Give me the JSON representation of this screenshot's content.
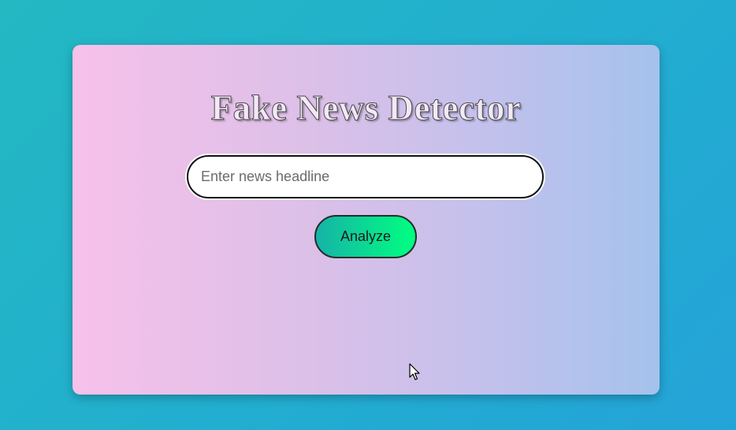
{
  "page": {
    "title": "Fake News Detector"
  },
  "search": {
    "placeholder": "Enter news headline",
    "value": ""
  },
  "actions": {
    "analyze_label": "Analyze"
  },
  "icons": {
    "cursor": "mouse-pointer-icon"
  },
  "colors": {
    "page_background": "#22b0cc",
    "card_gradient_start": "#f7c1ea",
    "card_gradient_end": "#a4c2ec",
    "button_gradient_start": "#16b3a8",
    "button_gradient_end": "#00ff80"
  }
}
